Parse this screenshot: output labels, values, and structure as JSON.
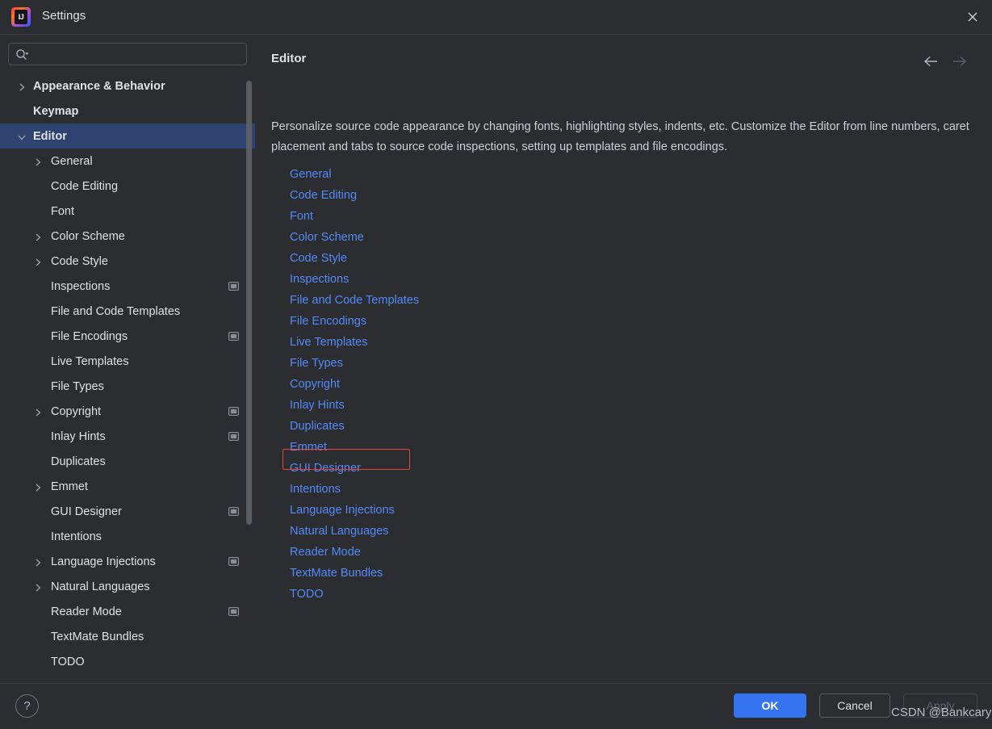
{
  "window": {
    "title": "Settings",
    "logo_icon": "intellij-idea-logo",
    "logo_text": "IJ",
    "close_icon": "close-icon"
  },
  "search": {
    "value": "",
    "placeholder": "",
    "icon": "search-icon"
  },
  "sidebar": {
    "items": [
      {
        "label": "Appearance & Behavior",
        "indent": 0,
        "chevron": "right",
        "bold": true,
        "selected": false,
        "badge": false
      },
      {
        "label": "Keymap",
        "indent": 0,
        "chevron": "none",
        "bold": true,
        "selected": false,
        "badge": false
      },
      {
        "label": "Editor",
        "indent": 0,
        "chevron": "down",
        "bold": true,
        "selected": true,
        "badge": false
      },
      {
        "label": "General",
        "indent": 1,
        "chevron": "right",
        "bold": false,
        "selected": false,
        "badge": false
      },
      {
        "label": "Code Editing",
        "indent": 1,
        "chevron": "none",
        "bold": false,
        "selected": false,
        "badge": false
      },
      {
        "label": "Font",
        "indent": 1,
        "chevron": "none",
        "bold": false,
        "selected": false,
        "badge": false
      },
      {
        "label": "Color Scheme",
        "indent": 1,
        "chevron": "right",
        "bold": false,
        "selected": false,
        "badge": false
      },
      {
        "label": "Code Style",
        "indent": 1,
        "chevron": "right",
        "bold": false,
        "selected": false,
        "badge": false
      },
      {
        "label": "Inspections",
        "indent": 1,
        "chevron": "none",
        "bold": false,
        "selected": false,
        "badge": true
      },
      {
        "label": "File and Code Templates",
        "indent": 1,
        "chevron": "none",
        "bold": false,
        "selected": false,
        "badge": false
      },
      {
        "label": "File Encodings",
        "indent": 1,
        "chevron": "none",
        "bold": false,
        "selected": false,
        "badge": true
      },
      {
        "label": "Live Templates",
        "indent": 1,
        "chevron": "none",
        "bold": false,
        "selected": false,
        "badge": false
      },
      {
        "label": "File Types",
        "indent": 1,
        "chevron": "none",
        "bold": false,
        "selected": false,
        "badge": false
      },
      {
        "label": "Copyright",
        "indent": 1,
        "chevron": "right",
        "bold": false,
        "selected": false,
        "badge": true
      },
      {
        "label": "Inlay Hints",
        "indent": 1,
        "chevron": "none",
        "bold": false,
        "selected": false,
        "badge": true
      },
      {
        "label": "Duplicates",
        "indent": 1,
        "chevron": "none",
        "bold": false,
        "selected": false,
        "badge": false
      },
      {
        "label": "Emmet",
        "indent": 1,
        "chevron": "right",
        "bold": false,
        "selected": false,
        "badge": false
      },
      {
        "label": "GUI Designer",
        "indent": 1,
        "chevron": "none",
        "bold": false,
        "selected": false,
        "badge": true
      },
      {
        "label": "Intentions",
        "indent": 1,
        "chevron": "none",
        "bold": false,
        "selected": false,
        "badge": false
      },
      {
        "label": "Language Injections",
        "indent": 1,
        "chevron": "right",
        "bold": false,
        "selected": false,
        "badge": true
      },
      {
        "label": "Natural Languages",
        "indent": 1,
        "chevron": "right",
        "bold": false,
        "selected": false,
        "badge": false
      },
      {
        "label": "Reader Mode",
        "indent": 1,
        "chevron": "none",
        "bold": false,
        "selected": false,
        "badge": true
      },
      {
        "label": "TextMate Bundles",
        "indent": 1,
        "chevron": "none",
        "bold": false,
        "selected": false,
        "badge": false
      },
      {
        "label": "TODO",
        "indent": 1,
        "chevron": "none",
        "bold": false,
        "selected": false,
        "badge": false
      }
    ]
  },
  "main": {
    "title": "Editor",
    "back_icon": "arrow-left-icon",
    "forward_icon": "arrow-right-icon",
    "description": "Personalize source code appearance by changing fonts, highlighting styles, indents, etc. Customize the Editor from line numbers, caret placement and tabs to source code inspections, setting up templates and file encodings.",
    "links": [
      {
        "label": "General",
        "highlighted": false
      },
      {
        "label": "Code Editing",
        "highlighted": false
      },
      {
        "label": "Font",
        "highlighted": false
      },
      {
        "label": "Color Scheme",
        "highlighted": false
      },
      {
        "label": "Code Style",
        "highlighted": false
      },
      {
        "label": "Inspections",
        "highlighted": false
      },
      {
        "label": "File and Code Templates",
        "highlighted": false
      },
      {
        "label": "File Encodings",
        "highlighted": false
      },
      {
        "label": "Live Templates",
        "highlighted": false
      },
      {
        "label": "File Types",
        "highlighted": false
      },
      {
        "label": "Copyright",
        "highlighted": false
      },
      {
        "label": "Inlay Hints",
        "highlighted": false
      },
      {
        "label": "Duplicates",
        "highlighted": false
      },
      {
        "label": "Emmet",
        "highlighted": false
      },
      {
        "label": "GUI Designer",
        "highlighted": false
      },
      {
        "label": "Intentions",
        "highlighted": true
      },
      {
        "label": "Language Injections",
        "highlighted": false
      },
      {
        "label": "Natural Languages",
        "highlighted": false
      },
      {
        "label": "Reader Mode",
        "highlighted": false
      },
      {
        "label": "TextMate Bundles",
        "highlighted": false
      },
      {
        "label": "TODO",
        "highlighted": false
      }
    ]
  },
  "footer": {
    "help_label": "?",
    "ok_label": "OK",
    "cancel_label": "Cancel",
    "apply_label": "Apply",
    "apply_disabled": true
  },
  "watermark": {
    "text": "CSDN @Bankcary"
  },
  "colors": {
    "background": "#2b2d30",
    "selection": "#2f4371",
    "link": "#548af7",
    "accent_button": "#3574f0",
    "annotation_box": "#e8453c",
    "text": "#dfe1e5"
  }
}
